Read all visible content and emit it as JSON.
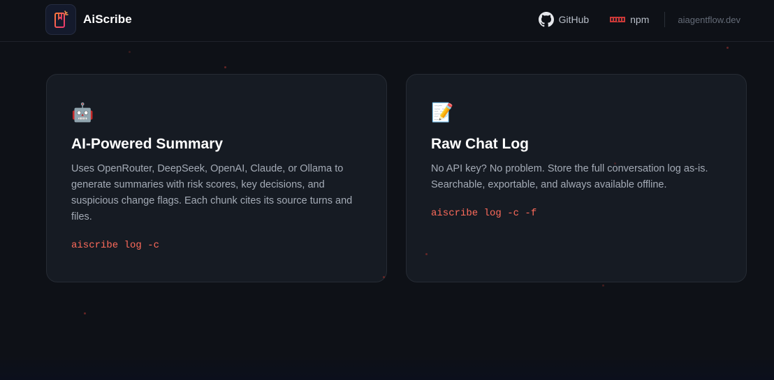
{
  "header": {
    "brand_name": "AiScribe",
    "logo_icon": "bookmark-sparkle-logo",
    "nav": {
      "github_label": "GitHub",
      "github_icon": "github-icon",
      "npm_label": "npm",
      "npm_icon": "npm-icon",
      "site_label": "aiagentflow.dev"
    }
  },
  "cards": [
    {
      "emoji": "🤖",
      "title": "AI-Powered Summary",
      "description": "Uses OpenRouter, DeepSeek, OpenAI, Claude, or Ollama to generate summaries with risk scores, key decisions, and suspicious change flags. Each chunk cites its source turns and files.",
      "command": "aiscribe log -c"
    },
    {
      "emoji": "📝",
      "title": "Raw Chat Log",
      "description": "No API key? No problem. Store the full conversation log as-is. Searchable, exportable, and always available offline.",
      "command": "aiscribe log -c -f"
    }
  ],
  "colors": {
    "background": "#0e1117",
    "card": "#161b23",
    "command": "#ff6b5b",
    "accent_logo": "#ff4f6a"
  }
}
